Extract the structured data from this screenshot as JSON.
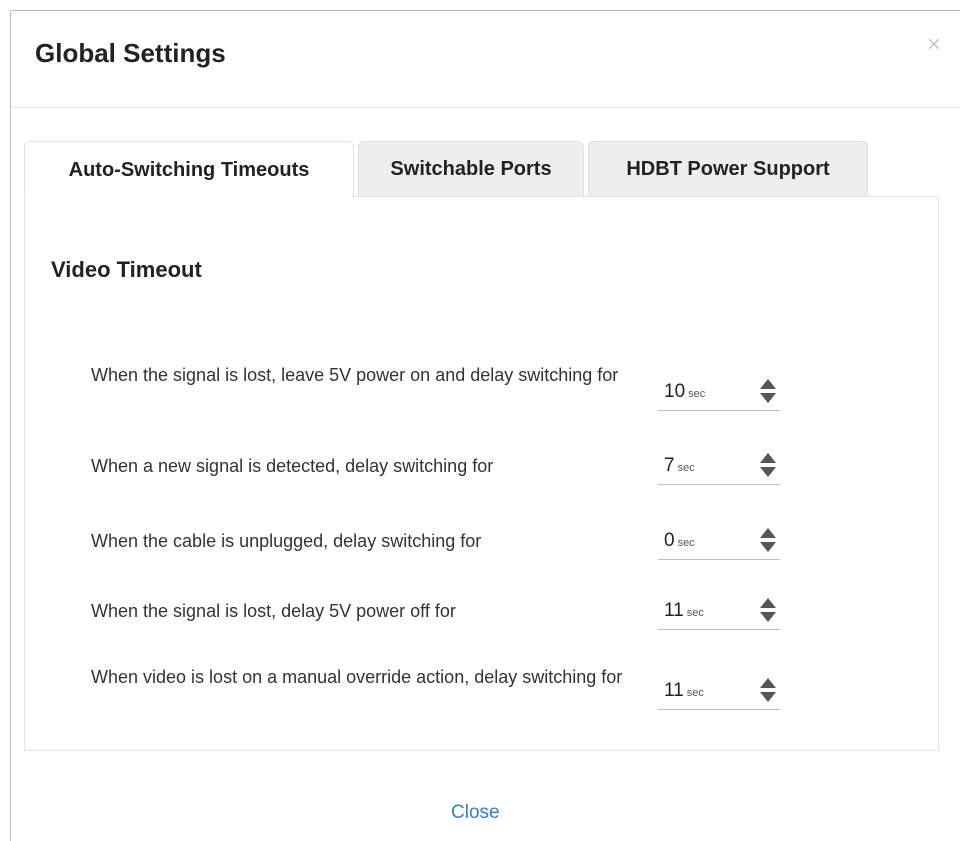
{
  "dialog": {
    "title": "Global Settings",
    "close_glyph": "×",
    "footer_close_label": "Close"
  },
  "tabs": [
    {
      "label": "Auto-Switching Timeouts",
      "active": true
    },
    {
      "label": "Switchable Ports",
      "active": false
    },
    {
      "label": "HDBT Power Support",
      "active": false
    }
  ],
  "section": {
    "title": "Video Timeout",
    "rows": [
      {
        "label": "When the signal is lost, leave 5V power on and delay switching for",
        "value": "10",
        "unit": "sec"
      },
      {
        "label": "When a new signal is detected, delay switching for",
        "value": "7",
        "unit": "sec"
      },
      {
        "label": "When the cable is unplugged, delay switching for",
        "value": "0",
        "unit": "sec"
      },
      {
        "label": "When the signal is lost, delay 5V power off for",
        "value": "11",
        "unit": "sec"
      },
      {
        "label": "When video is lost on a manual override action, delay switching for",
        "value": "11",
        "unit": "sec"
      }
    ]
  },
  "icons": {
    "stepper": "stepper-arrows-icon",
    "close": "close-icon"
  },
  "colors": {
    "link": "#3a7bc8",
    "tab_inactive": "#eeeeee"
  }
}
